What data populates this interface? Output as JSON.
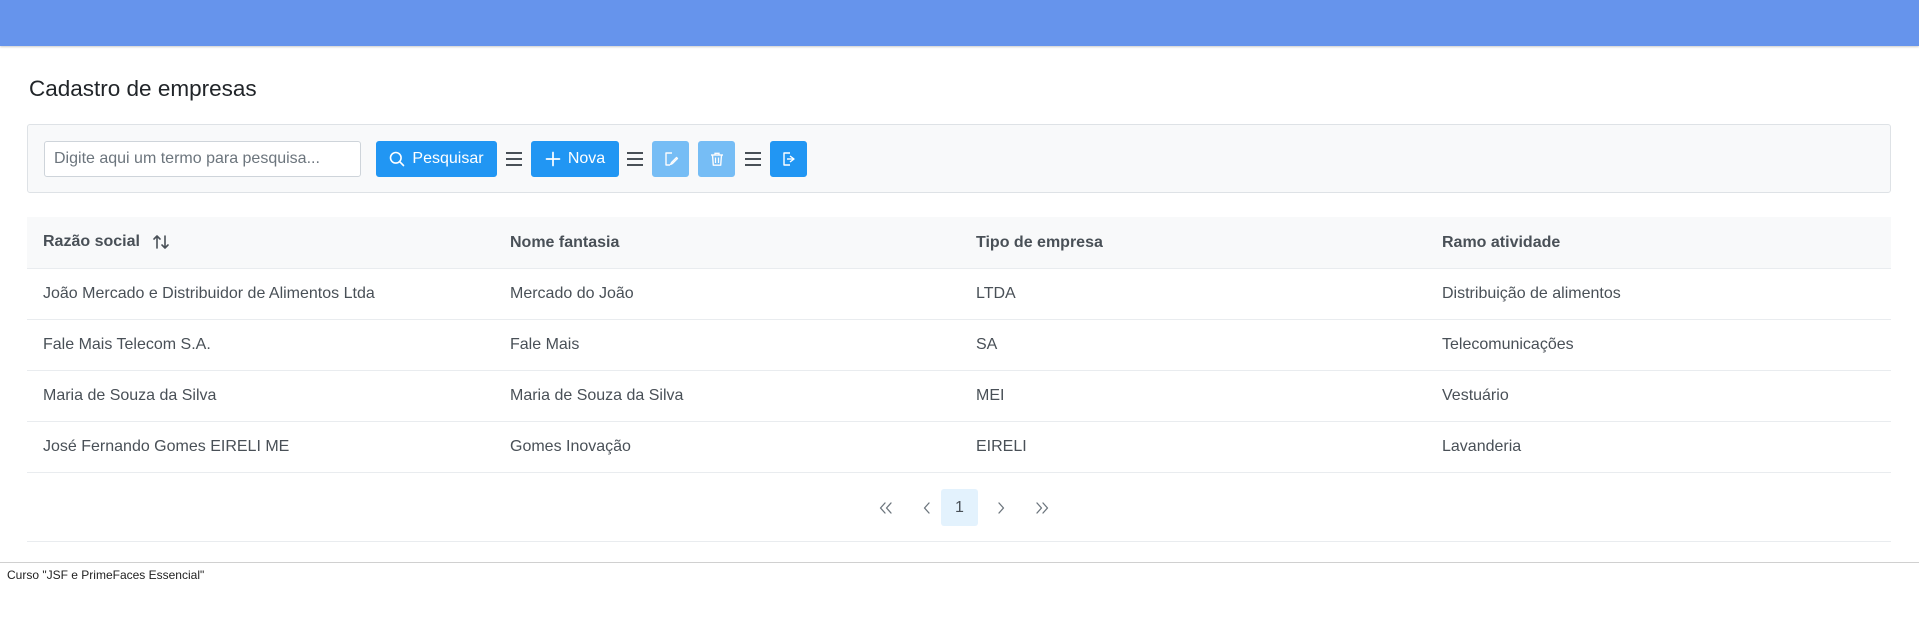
{
  "page": {
    "title": "Cadastro de empresas",
    "footer": "Curso \"JSF e PrimeFaces Essencial\""
  },
  "toolbar": {
    "search_placeholder": "Digite aqui um termo para pesquisa...",
    "search_value": "",
    "search_button_label": "Pesquisar",
    "new_button_label": "Nova",
    "edit_button_disabled": true,
    "delete_button_disabled": true
  },
  "table": {
    "columns": [
      "Razão social",
      "Nome fantasia",
      "Tipo de empresa",
      "Ramo atividade"
    ],
    "sorted_column": "Razão social",
    "rows": [
      [
        "João Mercado e Distribuidor de Alimentos Ltda",
        "Mercado do João",
        "LTDA",
        "Distribuição de alimentos"
      ],
      [
        "Fale Mais Telecom S.A.",
        "Fale Mais",
        "SA",
        "Telecomunicações"
      ],
      [
        "Maria de Souza da Silva",
        "Maria de Souza da Silva",
        "MEI",
        "Vestuário"
      ],
      [
        "José Fernando Gomes EIRELI ME",
        "Gomes Inovação",
        "EIRELI",
        "Lavanderia"
      ]
    ]
  },
  "paginator": {
    "current_page": "1"
  },
  "colors": {
    "topbar": "#6694ec",
    "primary": "#2196f3",
    "active_page_bg": "#e3f2fd"
  }
}
